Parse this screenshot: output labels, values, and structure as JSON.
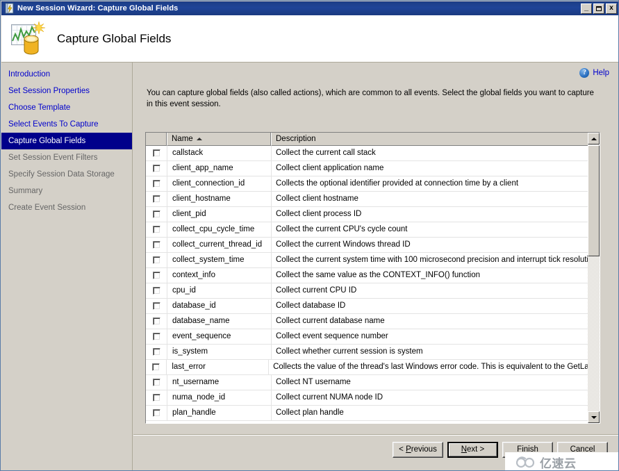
{
  "window": {
    "title": "New Session Wizard: Capture Global Fields",
    "title_icon": "event-session-lightning-icon",
    "minimize_label": "_",
    "maximize_label": "",
    "close_label": "x"
  },
  "banner": {
    "title": "Capture Global Fields",
    "icon": "chart-database-star-icon"
  },
  "sidebar": {
    "items": [
      {
        "label": "Introduction",
        "state": "done"
      },
      {
        "label": "Set Session Properties",
        "state": "done"
      },
      {
        "label": "Choose Template",
        "state": "done"
      },
      {
        "label": "Select Events To Capture",
        "state": "done"
      },
      {
        "label": "Capture Global Fields",
        "state": "active"
      },
      {
        "label": "Set Session Event Filters",
        "state": "future"
      },
      {
        "label": "Specify Session Data Storage",
        "state": "future"
      },
      {
        "label": "Summary",
        "state": "future"
      },
      {
        "label": "Create Event Session",
        "state": "future"
      }
    ]
  },
  "main": {
    "help_label": "Help",
    "help_icon": "question-circle-icon",
    "instructions": "You can capture global fields (also called actions), which are common to all events. Select the global fields you want to capture in this event session."
  },
  "grid": {
    "columns": [
      {
        "key": "check",
        "label": ""
      },
      {
        "key": "name",
        "label": "Name",
        "sort": "ascending"
      },
      {
        "key": "desc",
        "label": "Description"
      }
    ],
    "rows": [
      {
        "checked": false,
        "name": "callstack",
        "desc": "Collect the current call stack"
      },
      {
        "checked": false,
        "name": "client_app_name",
        "desc": "Collect client application name"
      },
      {
        "checked": false,
        "name": "client_connection_id",
        "desc": "Collects the optional identifier provided at connection time by a client"
      },
      {
        "checked": false,
        "name": "client_hostname",
        "desc": "Collect client hostname"
      },
      {
        "checked": false,
        "name": "client_pid",
        "desc": "Collect client process ID"
      },
      {
        "checked": false,
        "name": "collect_cpu_cycle_time",
        "desc": "Collect the current CPU's cycle count"
      },
      {
        "checked": false,
        "name": "collect_current_thread_id",
        "desc": "Collect the current Windows thread ID"
      },
      {
        "checked": false,
        "name": "collect_system_time",
        "desc": "Collect the current system time with 100 microsecond precision and interrupt tick resolution"
      },
      {
        "checked": false,
        "name": "context_info",
        "desc": "Collect the same value as the CONTEXT_INFO() function"
      },
      {
        "checked": false,
        "name": "cpu_id",
        "desc": "Collect current CPU ID"
      },
      {
        "checked": false,
        "name": "database_id",
        "desc": "Collect database ID"
      },
      {
        "checked": false,
        "name": "database_name",
        "desc": "Collect current database name"
      },
      {
        "checked": false,
        "name": "event_sequence",
        "desc": "Collect event sequence number"
      },
      {
        "checked": false,
        "name": "is_system",
        "desc": "Collect whether current session is system"
      },
      {
        "checked": false,
        "name": "last_error",
        "desc": "Collects the value of the thread's last Windows error code. This is equivalent to the GetLastE..."
      },
      {
        "checked": false,
        "name": "nt_username",
        "desc": "Collect NT username"
      },
      {
        "checked": false,
        "name": "numa_node_id",
        "desc": "Collect current NUMA node ID"
      },
      {
        "checked": false,
        "name": "plan_handle",
        "desc": "Collect plan handle"
      }
    ]
  },
  "footer": {
    "previous_label": "< Previous",
    "previous_accel": "P",
    "next_label": "Next >",
    "next_accel": "N",
    "finish_label": "Finish",
    "finish_accel": "F",
    "cancel_label": "Cancel",
    "cancel_accel": "C"
  },
  "watermark": {
    "text": "亿速云",
    "icon": "cloud-logo-icon"
  }
}
